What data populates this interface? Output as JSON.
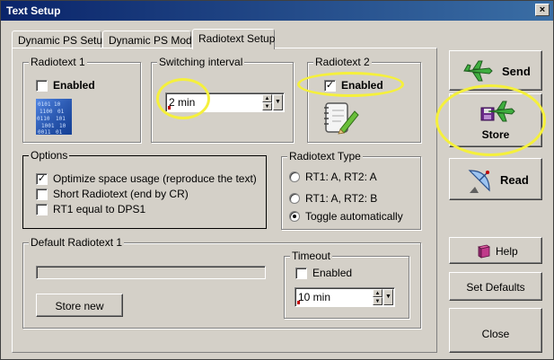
{
  "window": {
    "title": "Text Setup",
    "close_glyph": "×"
  },
  "tabs": [
    {
      "label": "Dynamic PS Setup"
    },
    {
      "label": "Dynamic PS Mode"
    },
    {
      "label": "Radiotext Setup"
    }
  ],
  "radiotext1": {
    "group_label": "Radiotext 1",
    "enabled_label": "Enabled",
    "enabled": false
  },
  "switching": {
    "group_label": "Switching interval",
    "value": "2 min"
  },
  "radiotext2": {
    "group_label": "Radiotext 2",
    "enabled_label": "Enabled",
    "enabled": true
  },
  "options": {
    "group_label": "Options",
    "items": [
      {
        "label": "Optimize space usage (reproduce the text)",
        "checked": true
      },
      {
        "label": "Short Radiotext (end by CR)",
        "checked": false
      },
      {
        "label": "RT1 equal to DPS1",
        "checked": false
      }
    ]
  },
  "radiotext_type": {
    "group_label": "Radiotext Type",
    "items": [
      {
        "label": "RT1: A, RT2: A",
        "selected": false
      },
      {
        "label": "RT1: A, RT2: B",
        "selected": false
      },
      {
        "label": "Toggle automatically",
        "selected": true
      }
    ]
  },
  "default_rt": {
    "group_label": "Default Radiotext 1",
    "store_new_label": "Store new"
  },
  "timeout": {
    "group_label": "Timeout",
    "enabled_label": "Enabled",
    "enabled": false,
    "value": "10 min"
  },
  "side_buttons": {
    "send": "Send",
    "store": "Store",
    "read": "Read",
    "help": "Help",
    "set_defaults": "Set Defaults",
    "close": "Close"
  },
  "check_glyph": "✓",
  "colors": {
    "title_start": "#0a246a",
    "title_end": "#3a6ea5",
    "face": "#d4d0c8",
    "highlight": "#f5f03c"
  }
}
